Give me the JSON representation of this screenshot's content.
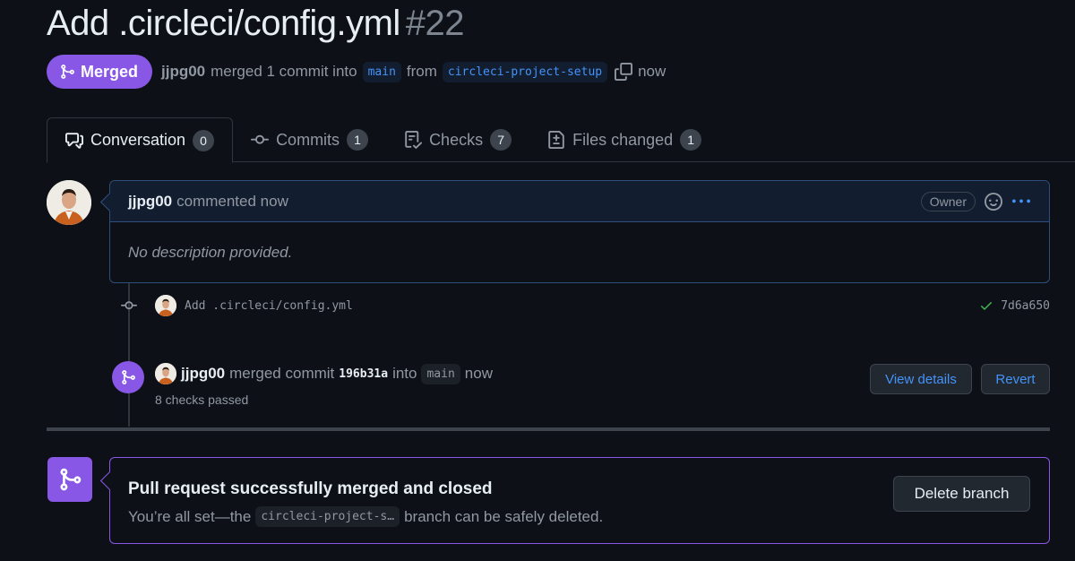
{
  "pr": {
    "title": "Add .circleci/config.yml",
    "number": "#22",
    "state": "Merged",
    "author": "jjpg00",
    "merged_text": "merged 1 commit into",
    "base_branch": "main",
    "from_text": "from",
    "head_branch": "circleci-project-setup",
    "time": "now"
  },
  "tabs": [
    {
      "label": "Conversation",
      "count": "0",
      "icon": "comment-discussion-icon"
    },
    {
      "label": "Commits",
      "count": "1",
      "icon": "git-commit-icon"
    },
    {
      "label": "Checks",
      "count": "7",
      "icon": "checklist-icon"
    },
    {
      "label": "Files changed",
      "count": "1",
      "icon": "file-diff-icon"
    }
  ],
  "comment": {
    "author": "jjpg00",
    "action": "commented now",
    "badge": "Owner",
    "body": "No description provided."
  },
  "commit": {
    "message": "Add .circleci/config.yml",
    "sha": "7d6a650",
    "status_color": "#3fb950"
  },
  "merge_event": {
    "author": "jjpg00",
    "action": "merged commit",
    "sha": "196b31a",
    "into": "into",
    "branch": "main",
    "time": "now",
    "checks": "8 checks passed",
    "view_details": "View details",
    "revert": "Revert"
  },
  "merged_box": {
    "title": "Pull request successfully merged and closed",
    "desc_prefix": "You’re all set—the",
    "branch": "circleci-project-s…",
    "desc_suffix": "branch can be safely deleted.",
    "delete_button": "Delete branch"
  },
  "colors": {
    "background": "#0d1117",
    "merged_purple": "#8957e5",
    "link_blue": "#4493f8",
    "muted": "#9198a1"
  }
}
